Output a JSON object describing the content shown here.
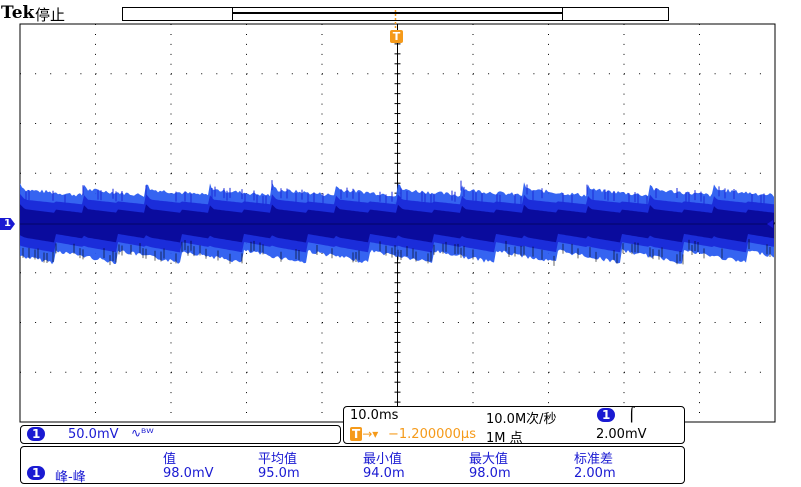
{
  "header": {
    "brand": "Tek",
    "status": "停止",
    "trigger_marker": "T"
  },
  "colors": {
    "grid": "#000000",
    "waveform_dark": "#0a0a9a",
    "waveform_mid": "#1a2ad8",
    "waveform_light": "#2a5cf0",
    "channel": "#1a1ad2",
    "trigger": "#f59a1a"
  },
  "channel_bar": {
    "channel": "1",
    "scale": "50.0mV",
    "icon": "bandwidth-limit-icon"
  },
  "timebase": {
    "time_per_div": "10.0ms",
    "sample_rate": "10.0M次/秒",
    "trigger_channel": "1",
    "trigger_slope": "rising-edge-icon",
    "trigger_delay": "−1.200000µs",
    "record_length": "1M 点",
    "trigger_level": "2.00mV"
  },
  "measurements": {
    "headers": [
      "值",
      "平均值",
      "最小值",
      "最大值",
      "标准差"
    ],
    "row": {
      "channel": "1",
      "label": "峰-峰",
      "values": [
        "98.0mV",
        "95.0m",
        "94.0m",
        "98.0m",
        "2.00m"
      ]
    }
  },
  "chart_data": {
    "type": "line",
    "title": "",
    "xlabel": "",
    "ylabel": "",
    "grid": true,
    "x_divisions": 10,
    "y_divisions": 8,
    "series": [
      {
        "channel": "1",
        "pattern": "sawtooth ripple envelope",
        "periods": 12,
        "volts_per_div": 0.05,
        "offset_div": 0.0,
        "peak_to_peak_V": 0.098
      }
    ]
  }
}
